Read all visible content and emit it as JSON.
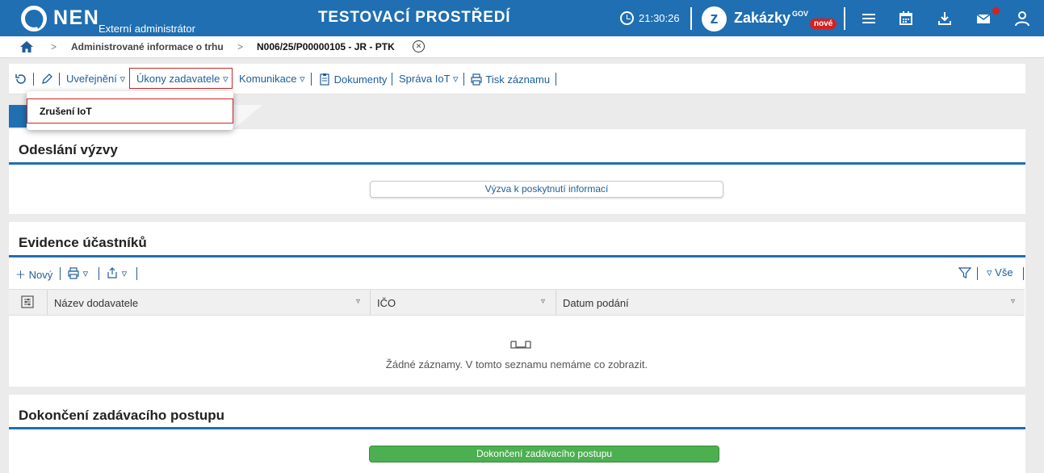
{
  "header": {
    "brand": "NEN",
    "brand_sub": "Externí administrátor",
    "env_title": "TESTOVACÍ PROSTŘEDÍ",
    "time": "21:30:26",
    "zk_letter": "z",
    "zk_name": "Zakázky",
    "zk_gov": "GOV",
    "zk_badge": "nové",
    "brand_color": "#1f6fb2",
    "icons": [
      "menu-icon",
      "calendar-icon",
      "download-icon",
      "mail-icon",
      "user-icon"
    ]
  },
  "breadcrumb": {
    "item1": "Administrované informace o trhu",
    "item2": "N006/25/P00000105 - JR - PTK",
    "close": "✕"
  },
  "toolbar": {
    "uverejneni": "Uveřejnění",
    "ukony": "Úkony zadavatele",
    "komunikace": "Komunikace",
    "dokumenty": "Dokumenty",
    "sprava": "Správa IoT",
    "tisk": "Tisk záznamu",
    "caret": "▿"
  },
  "dropdown": {
    "items": [
      {
        "label": "Zrušení IoT"
      }
    ]
  },
  "sections": {
    "odeslani": {
      "title": "Odeslání výzvy",
      "button": "Výzva k poskytnutí informací"
    },
    "evidence": {
      "title": "Evidence účastníků",
      "new": "Nový",
      "filter_all": "Vše",
      "columns": [
        "Název dodavatele",
        "IČO",
        "Datum podání"
      ],
      "empty_text": "Žádné záznamy. V tomto seznamu nemáme co zobrazit."
    },
    "dokonceni": {
      "title": "Dokončení zadávacího postupu",
      "button": "Dokončení zadávacího postupu",
      "button_color": "#4caf50"
    }
  }
}
